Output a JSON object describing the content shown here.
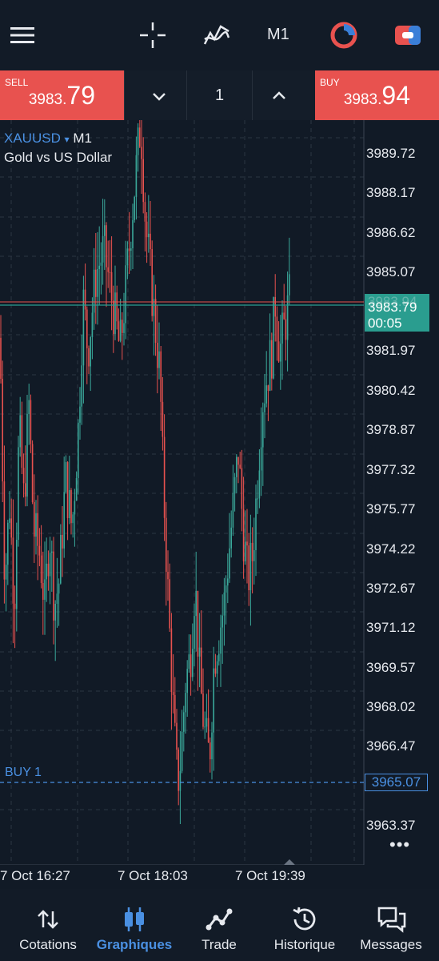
{
  "toolbar": {
    "timeframe": "M1"
  },
  "trade": {
    "sell_label": "SELL",
    "sell_price_small": "3983.",
    "sell_price_big": "79",
    "buy_label": "BUY",
    "buy_price_small": "3983.",
    "buy_price_big": "94",
    "volume": "1"
  },
  "chart": {
    "symbol": "XAUUSD",
    "arrow": "▾",
    "timeframe": "M1",
    "description": "Gold vs US Dollar",
    "price_labels": [
      "3989.72",
      "3988.17",
      "3986.62",
      "3985.07",
      "3981.97",
      "3980.42",
      "3978.87",
      "3977.32",
      "3975.77",
      "3974.22",
      "3972.67",
      "3971.12",
      "3969.57",
      "3968.02",
      "3966.47",
      "3963.37"
    ],
    "time_labels": [
      "7 Oct 16:27",
      "7 Oct 18:03",
      "7 Oct 19:39"
    ],
    "current_price": "3983.79",
    "hidden_price": "3983.94",
    "countdown": "00:05",
    "order_label": "BUY 1",
    "order_price": "3965.07",
    "more": "•••"
  },
  "colors": {
    "bull": "#3aa89a",
    "bear": "#e8524f",
    "accent": "#4a90e2",
    "bg": "#111a26"
  },
  "nav": {
    "items": [
      {
        "label": "Cotations",
        "icon": "sort-arrows-icon"
      },
      {
        "label": "Graphiques",
        "icon": "candles-icon"
      },
      {
        "label": "Trade",
        "icon": "trend-icon"
      },
      {
        "label": "Historique",
        "icon": "history-icon"
      },
      {
        "label": "Messages",
        "icon": "messages-icon"
      }
    ]
  }
}
